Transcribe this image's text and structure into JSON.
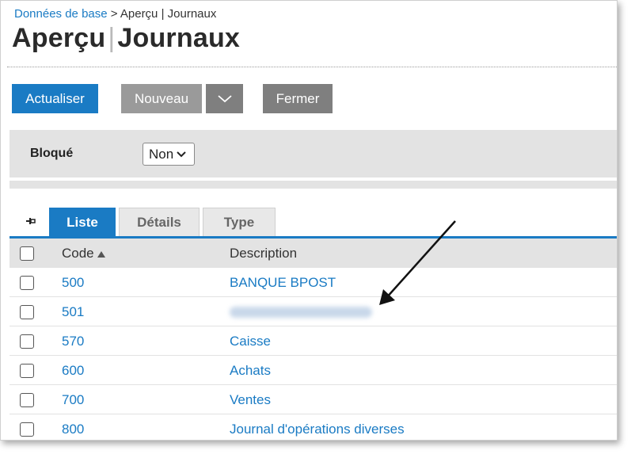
{
  "breadcrumb": {
    "link": "Données de base",
    "separator": " > ",
    "current": "Aperçu | Journaux"
  },
  "title": {
    "part1": "Aperçu",
    "separator": "|",
    "part2": "Journaux"
  },
  "toolbar": {
    "refresh_label": "Actualiser",
    "new_label": "Nouveau",
    "close_label": "Fermer"
  },
  "filter": {
    "label": "Bloqué",
    "value": "Non"
  },
  "tabs": [
    {
      "label": "Liste"
    },
    {
      "label": "Détails"
    },
    {
      "label": "Type"
    }
  ],
  "table": {
    "headers": {
      "code": "Code",
      "description": "Description"
    },
    "rows": [
      {
        "code": "500",
        "description": "BANQUE BPOST"
      },
      {
        "code": "501",
        "description": ""
      },
      {
        "code": "570",
        "description": "Caisse"
      },
      {
        "code": "600",
        "description": "Achats"
      },
      {
        "code": "700",
        "description": "Ventes"
      },
      {
        "code": "800",
        "description": "Journal d'opérations diverses"
      }
    ]
  },
  "colors": {
    "accent": "#1a7bc4",
    "button_gray": "#9a9a9a",
    "button_dark_gray": "#7f7f7f",
    "panel_gray": "#e3e3e3"
  },
  "icons": {
    "pin": "pin-icon",
    "dropdown": "chevron-down-icon",
    "sort": "sort-ascending-icon",
    "annotation": "arrow-icon"
  }
}
